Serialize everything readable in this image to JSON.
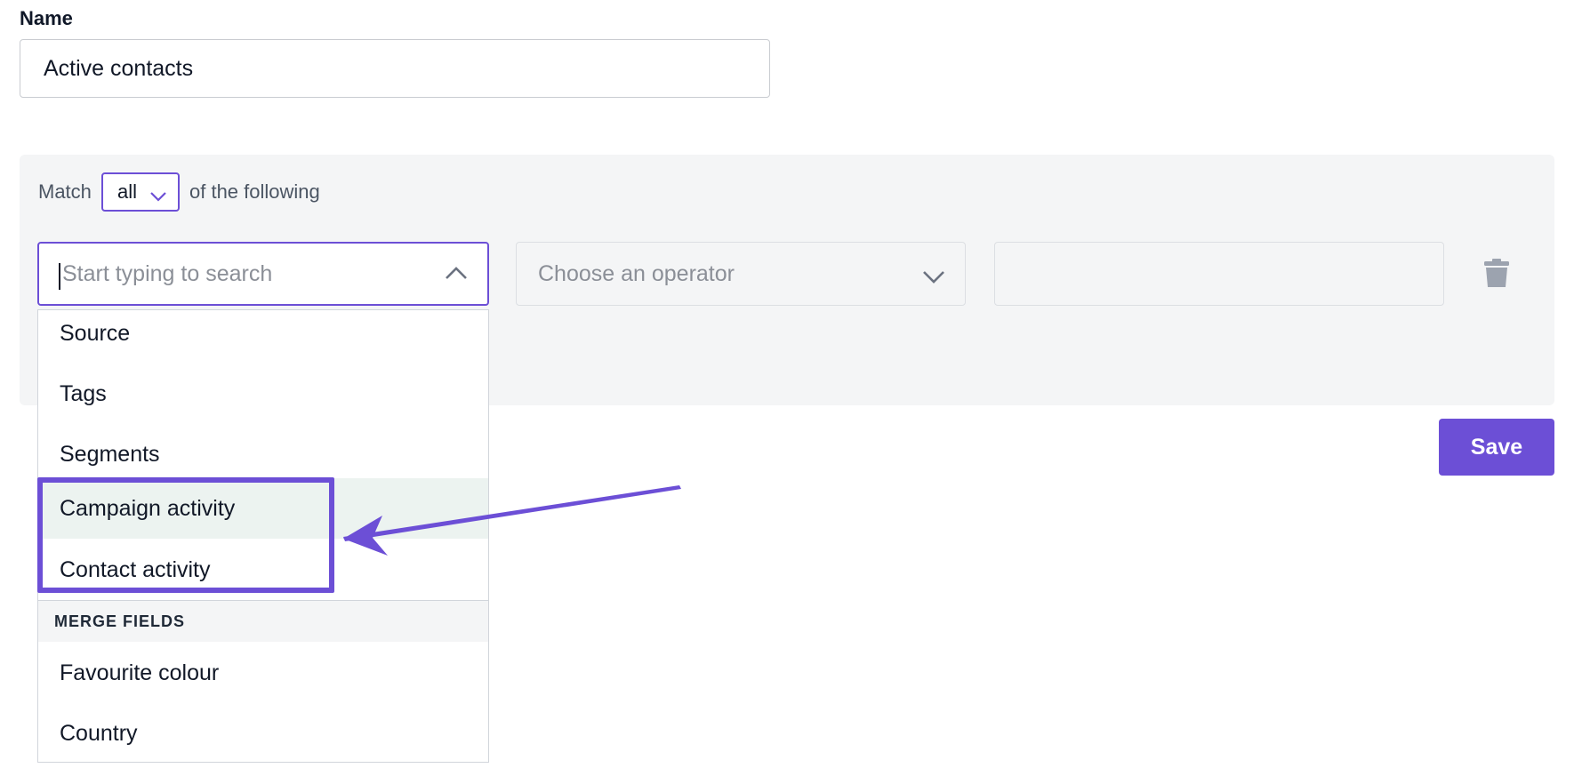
{
  "form": {
    "name_label": "Name",
    "name_value": "Active contacts",
    "save_label": "Save"
  },
  "rules": {
    "match_prefix": "Match",
    "match_value": "all",
    "match_suffix": "of the following",
    "field_placeholder": "Start typing to search",
    "operator_placeholder": "Choose an operator",
    "value_input": ""
  },
  "dropdown": {
    "items": [
      {
        "label": "Source",
        "highlighted": false
      },
      {
        "label": "Tags",
        "highlighted": false
      },
      {
        "label": "Segments",
        "highlighted": false
      },
      {
        "label": "Campaign activity",
        "highlighted": true
      },
      {
        "label": "Contact activity",
        "highlighted": false
      }
    ],
    "merge_fields_header": "MERGE FIELDS",
    "merge_fields": [
      {
        "label": "Favourite colour"
      },
      {
        "label": "Country"
      }
    ]
  },
  "annotation": {
    "color": "#6c4fd6",
    "highlighted_items": [
      "Campaign activity",
      "Contact activity"
    ]
  },
  "colors": {
    "accent": "#6c4fd6",
    "panel_bg": "#f4f5f6",
    "hover_bg": "#ecf3f0"
  },
  "icons": {
    "match_select": "chevron-down-icon",
    "field_search": "chevron-up-icon",
    "operator_select": "chevron-down-icon",
    "delete_rule": "trash-icon"
  }
}
